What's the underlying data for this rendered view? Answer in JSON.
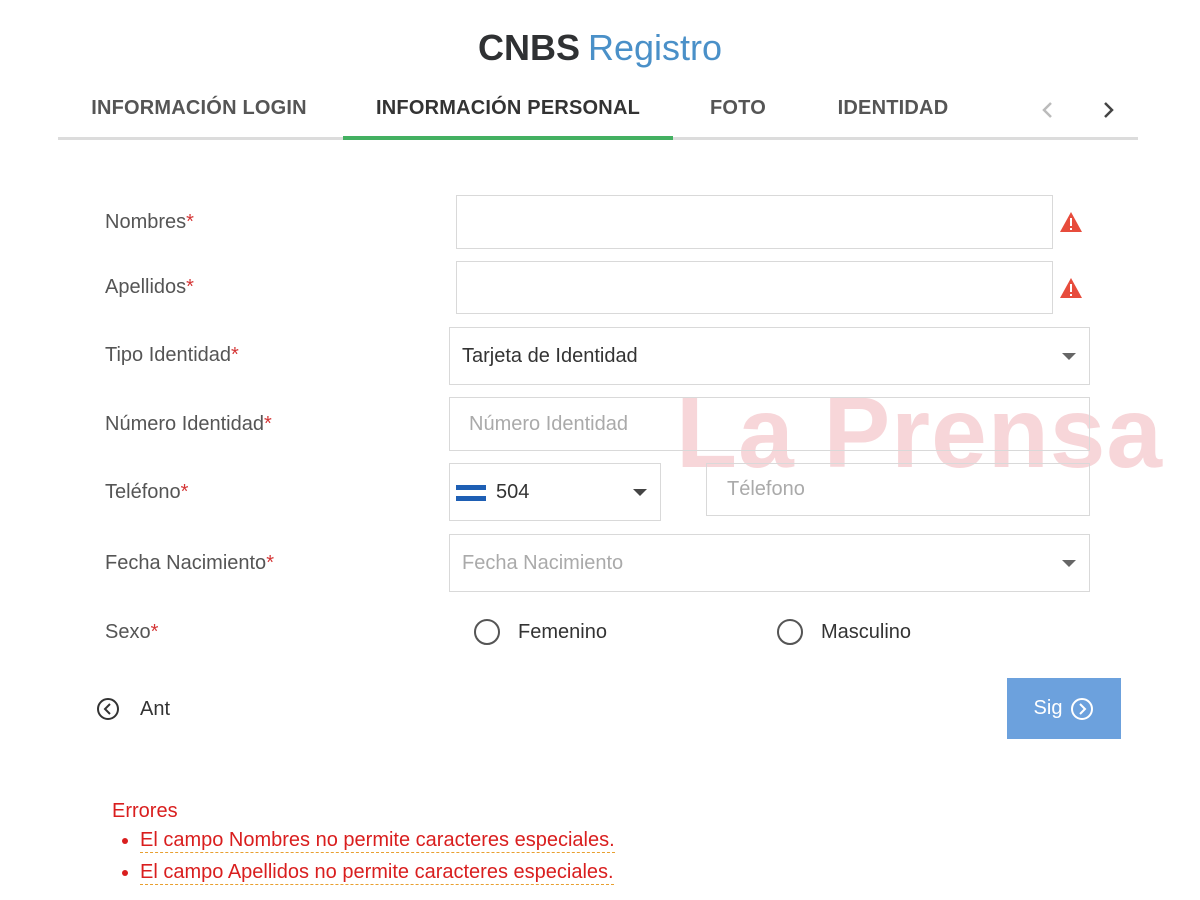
{
  "header": {
    "brand": "CNBS",
    "subtitle": "Registro"
  },
  "tabs": [
    {
      "label": "INFORMACIÓN LOGIN",
      "active": false
    },
    {
      "label": "INFORMACIÓN PERSONAL",
      "active": true
    },
    {
      "label": "FOTO",
      "active": false
    },
    {
      "label": "IDENTIDAD",
      "active": false
    }
  ],
  "tab_nav": {
    "prev_icon": "chevron-left-icon",
    "next_icon": "chevron-right-icon"
  },
  "colors": {
    "active_tab": "#43b061",
    "required": "#d43535",
    "error": "#d91e1e",
    "primary_button": "#6ca1dd",
    "warning": "#e74c3c"
  },
  "form": {
    "required_mark": "*",
    "nombres": {
      "label": "Nombres",
      "value": "",
      "status_icon": "warning-icon"
    },
    "apellidos": {
      "label": "Apellidos",
      "value": "",
      "status_icon": "warning-icon"
    },
    "tipo_identidad": {
      "label": "Tipo Identidad",
      "value": "Tarjeta de Identidad"
    },
    "numero_identidad": {
      "label": "Número Identidad",
      "placeholder": "Número Identidad"
    },
    "telefono": {
      "label": "Teléfono",
      "country_code": "504",
      "flag_icon": "honduras-flag-icon",
      "placeholder": "Télefono"
    },
    "fecha_nacimiento": {
      "label": "Fecha Nacimiento",
      "placeholder": "Fecha Nacimiento"
    },
    "sexo": {
      "label": "Sexo",
      "options": [
        "Femenino",
        "Masculino"
      ],
      "selected": null
    }
  },
  "navigation": {
    "prev_label": "Ant",
    "next_label": "Sig"
  },
  "watermark": "La Prensa",
  "errors": {
    "title": "Errores",
    "items": [
      "El campo Nombres no permite caracteres especiales.",
      "El campo Apellidos no permite caracteres especiales."
    ]
  }
}
